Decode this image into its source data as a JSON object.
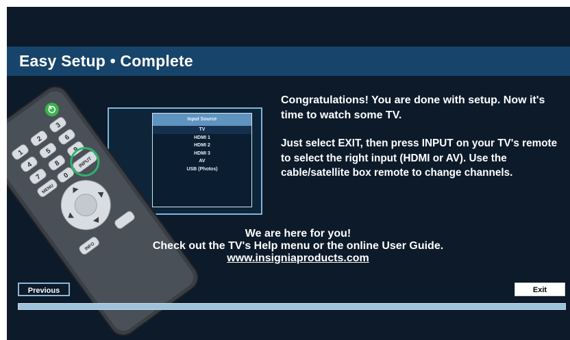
{
  "title": "Easy Setup • Complete",
  "input_menu": {
    "header": "Input Source",
    "items": [
      "TV",
      "HDMI 1",
      "HDMI 2",
      "HDMI 3",
      "AV",
      "USB (Photos)"
    ],
    "selected": "TV"
  },
  "remote": {
    "input_label": "INPUT",
    "menu_label": "MENU",
    "info_label": "INFO",
    "digits": [
      "1",
      "2",
      "3",
      "4",
      "5",
      "6",
      "7",
      "8",
      "9",
      "0"
    ]
  },
  "message": {
    "line1": "Congratulations! You are done with setup. Now it's time to watch some TV.",
    "line2": "Just select EXIT, then press INPUT on your TV's remote to select the right input (HDMI or AV). Use the cable/satellite box remote to change channels."
  },
  "help": {
    "line1": "We are here for you!",
    "line2": "Check out the TV's Help menu or the online User Guide.",
    "link": "www.insigniaproducts.com"
  },
  "buttons": {
    "previous": "Previous",
    "exit": "Exit"
  },
  "progress": {
    "fraction": 1.0
  },
  "colors": {
    "background": "#0c1a2a",
    "title_bar": "#17446a",
    "highlight_ring": "#2fb36b",
    "power_button": "#39b54a",
    "progress": "#8fb4cf"
  }
}
